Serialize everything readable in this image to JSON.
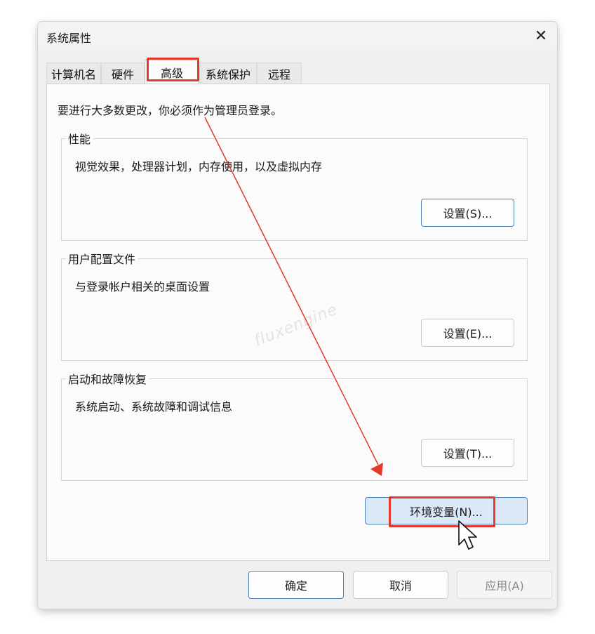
{
  "window": {
    "title": "系统属性",
    "close_label": "✕"
  },
  "tabs": [
    {
      "label": "计算机名"
    },
    {
      "label": "硬件"
    },
    {
      "label": "高级"
    },
    {
      "label": "系统保护"
    },
    {
      "label": "远程"
    }
  ],
  "active_tab": "高级",
  "admin_note": "要进行大多数更改，你必须作为管理员登录。",
  "groups": {
    "performance": {
      "title": "性能",
      "desc": "视觉效果，处理器计划，内存使用，以及虚拟内存",
      "button": "设置(S)..."
    },
    "profiles": {
      "title": "用户配置文件",
      "desc": "与登录帐户相关的桌面设置",
      "button": "设置(E)..."
    },
    "startup": {
      "title": "启动和故障恢复",
      "desc": "系统启动、系统故障和调试信息",
      "button": "设置(T)..."
    }
  },
  "env_button": "环境变量(N)...",
  "footer": {
    "ok": "确定",
    "cancel": "取消",
    "apply": "应用(A)"
  },
  "watermark": "fluxengine",
  "colors": {
    "highlight": "#e53a2a",
    "focus_button": "#dbe8f7",
    "primary_border": "#4d7fb8"
  },
  "icons": {
    "close": "close-icon",
    "cursor": "mouse-pointer-icon",
    "arrow": "annotation-arrow-icon"
  }
}
